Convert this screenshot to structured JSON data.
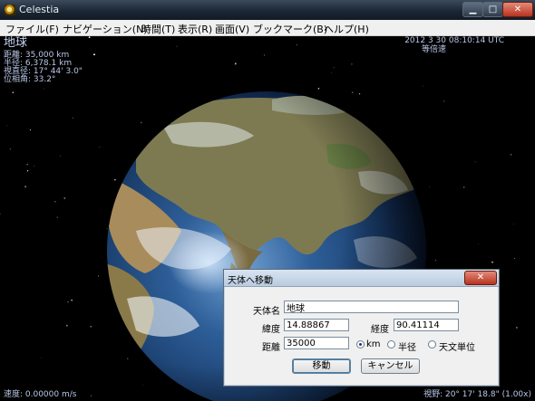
{
  "window": {
    "title": "Celestia",
    "minimize_glyph": "▁",
    "maximize_glyph": "□",
    "close_glyph": "✕"
  },
  "menu": [
    "ファイル(F)",
    "ナビゲーション(N)",
    "時間(T)",
    "表示(R)",
    "画面(V)",
    "ブックマーク(B)",
    "ヘルプ(H)"
  ],
  "hud": {
    "object_name": "地球",
    "distance": "距離: 35,000 km",
    "radius": "半径: 6,378.1 km",
    "apparent_diameter": "視直径: 17° 44' 3.0\"",
    "phase_angle": "位相角: 33.2°",
    "datetime": "2012 3 30 08:10:14 UTC",
    "time_rate": "等倍速",
    "speed": "速度: 0.00000 m/s",
    "fov": "視野: 20° 17' 18.8\" (1.00x)"
  },
  "dialog": {
    "title": "天体へ移動",
    "close_glyph": "✕",
    "object_label": "天体名",
    "object_value": "地球",
    "latitude_label": "緯度",
    "latitude_value": "14.88867",
    "longitude_label": "経度",
    "longitude_value": "90.41114",
    "distance_label": "距離",
    "distance_value": "35000",
    "units": [
      {
        "label": "km",
        "checked": true
      },
      {
        "label": "半径",
        "checked": false
      },
      {
        "label": "天文単位",
        "checked": false
      }
    ],
    "go_button": "移動",
    "cancel_button": "キャンセル"
  }
}
